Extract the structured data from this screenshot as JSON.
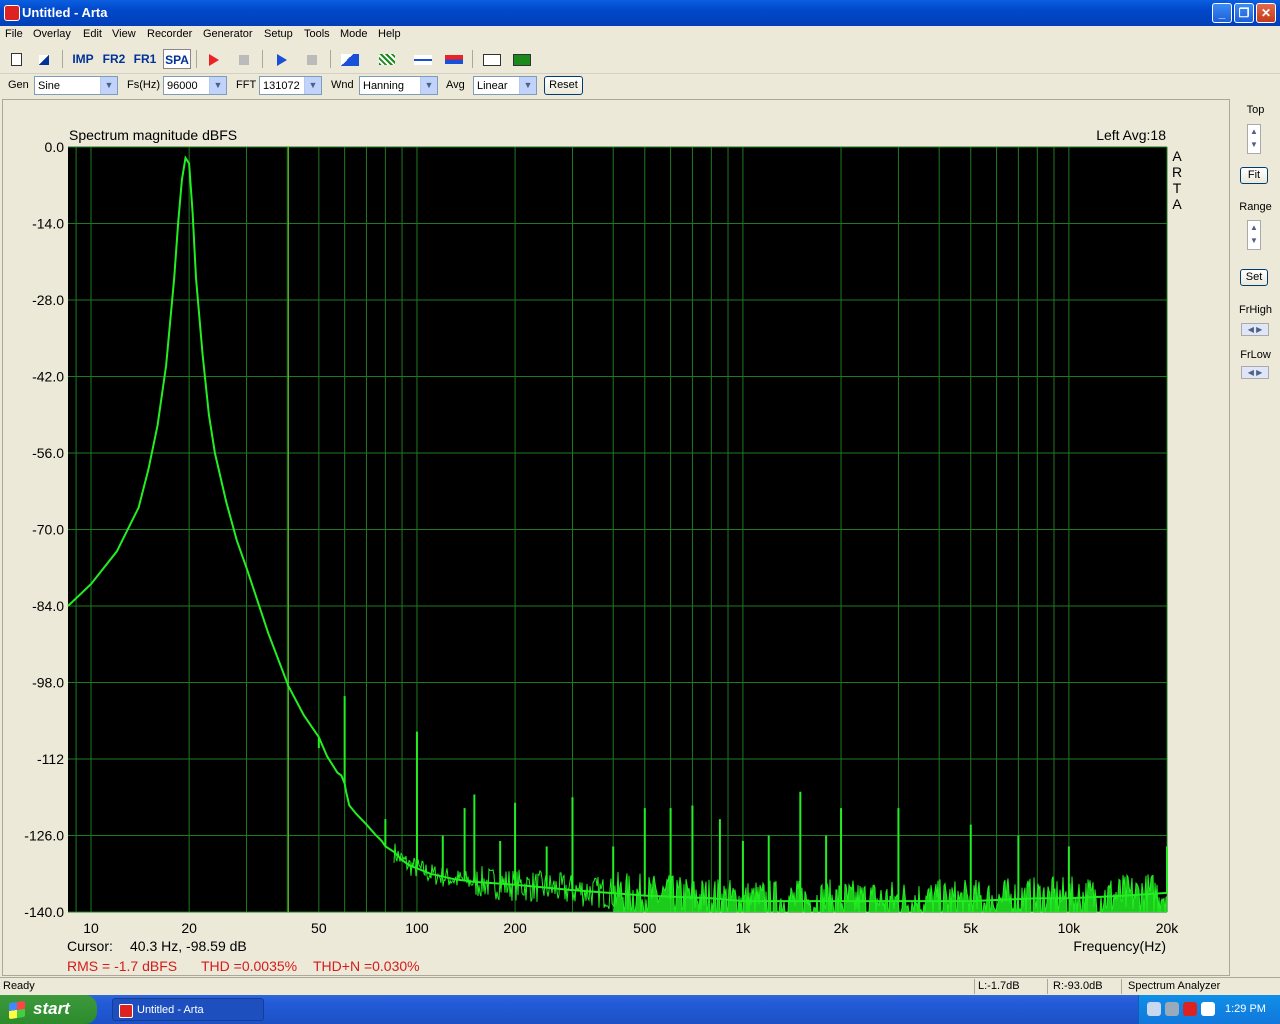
{
  "window": {
    "title": "Untitled - Arta",
    "minimize": "_",
    "maximize": "❐",
    "close": "✕"
  },
  "menu": [
    "File",
    "Overlay",
    "Edit",
    "View",
    "Recorder",
    "Generator",
    "Setup",
    "Tools",
    "Mode",
    "Help"
  ],
  "toolbar": {
    "imp": "IMP",
    "fr2": "FR2",
    "fr1": "FR1",
    "spa": "SPA"
  },
  "controls": {
    "gen_label": "Gen",
    "gen_value": "Sine",
    "fs_label": "Fs(Hz)",
    "fs_value": "96000",
    "fft_label": "FFT",
    "fft_value": "131072",
    "wnd_label": "Wnd",
    "wnd_value": "Hanning",
    "avg_label": "Avg",
    "avg_value": "Linear",
    "reset_label": "Reset"
  },
  "right_panel": {
    "top_label": "Top",
    "fit_label": "Fit",
    "range_label": "Range",
    "set_label": "Set",
    "frhigh_label": "FrHigh",
    "frlow_label": "FrLow"
  },
  "plot": {
    "title": "Spectrum magnitude dBFS",
    "channel_info": "Left  Avg:18",
    "brand": "ARTA",
    "xlabel": "Frequency(Hz)",
    "cursor_label": "Cursor:",
    "cursor_value": "40.3 Hz, -98.59 dB",
    "rms_text": "RMS =   -1.7 dBFS",
    "thd_text": "THD =0.0035%",
    "thdn_text": "THD+N =0.030%"
  },
  "chart_data": {
    "type": "line",
    "title": "Spectrum magnitude dBFS",
    "xlabel": "Frequency(Hz)",
    "ylabel": "",
    "x_scale": "log",
    "xlim": [
      8.5,
      20000
    ],
    "ylim": [
      -140,
      0
    ],
    "y_ticks": [
      "0.0",
      "-14.0",
      "-28.0",
      "-42.0",
      "-56.0",
      "-70.0",
      "-84.0",
      "-98.0",
      "-112",
      "-126.0",
      "-140.0"
    ],
    "y_tick_values": [
      0,
      -14,
      -28,
      -42,
      -56,
      -70,
      -84,
      -98,
      -112,
      -126,
      -140
    ],
    "x_ticks": [
      "10",
      "20",
      "50",
      "100",
      "200",
      "500",
      "1k",
      "2k",
      "5k",
      "10k",
      "20k"
    ],
    "x_tick_values": [
      10,
      20,
      50,
      100,
      200,
      500,
      1000,
      2000,
      5000,
      10000,
      20000
    ],
    "cursor_x": 40.3,
    "grid": true,
    "colors": {
      "background": "#000000",
      "grid": "#1f7a1f",
      "trace": "#22ee22",
      "cursor": "#6ccf2a"
    },
    "series": [
      {
        "x": [
          8.5,
          10,
          12,
          14,
          15,
          16,
          17,
          18,
          18.5,
          19,
          19.5,
          20,
          20.5,
          21,
          22,
          23,
          24,
          26,
          28,
          30,
          35,
          40.3,
          45,
          50,
          53,
          57,
          58.6,
          60,
          60.6,
          62,
          65,
          70,
          75,
          78,
          80,
          85,
          90,
          95,
          100,
          110,
          130,
          150,
          200,
          300,
          500,
          800,
          1000,
          1500,
          2000,
          3000,
          5000,
          8000,
          10000,
          15000,
          20000
        ],
        "y": [
          -84,
          -80,
          -74,
          -66,
          -59,
          -51,
          -40,
          -24,
          -14,
          -6,
          -2,
          -3,
          -12,
          -24,
          -38,
          -49,
          -56,
          -65,
          -72,
          -77,
          -89,
          -98.6,
          -104,
          -108,
          -111.5,
          -114.5,
          -115,
          -116.5,
          -118,
          -120.5,
          -122,
          -124,
          -126,
          -127,
          -128,
          -129,
          -130.5,
          -131.5,
          -132,
          -133,
          -134,
          -134.5,
          -135,
          -136,
          -137,
          -137.5,
          -138,
          -138,
          -138,
          -138,
          -138,
          -137.5,
          -137.5,
          -137,
          -136.5
        ]
      }
    ],
    "peaks": [
      {
        "x": 50,
        "y": -110
      },
      {
        "x": 60,
        "y": -100.5
      },
      {
        "x": 80,
        "y": -123
      },
      {
        "x": 100,
        "y": -107
      },
      {
        "x": 120,
        "y": -126
      },
      {
        "x": 140,
        "y": -121
      },
      {
        "x": 150,
        "y": -118.5
      },
      {
        "x": 180,
        "y": -127
      },
      {
        "x": 200,
        "y": -120
      },
      {
        "x": 250,
        "y": -128
      },
      {
        "x": 300,
        "y": -119
      },
      {
        "x": 400,
        "y": -128
      },
      {
        "x": 500,
        "y": -121
      },
      {
        "x": 600,
        "y": -121
      },
      {
        "x": 700,
        "y": -120.5
      },
      {
        "x": 850,
        "y": -123
      },
      {
        "x": 1000,
        "y": -127
      },
      {
        "x": 1200,
        "y": -126
      },
      {
        "x": 1500,
        "y": -118
      },
      {
        "x": 1800,
        "y": -126
      },
      {
        "x": 2000,
        "y": -121
      },
      {
        "x": 3000,
        "y": -121
      },
      {
        "x": 5000,
        "y": -124
      },
      {
        "x": 7000,
        "y": -126
      },
      {
        "x": 10000,
        "y": -128
      },
      {
        "x": 20000,
        "y": -128
      }
    ]
  },
  "status": {
    "ready": "Ready",
    "left_level": "L:-1.7dB",
    "right_level": "R:-93.0dB",
    "mode": "Spectrum Analyzer"
  },
  "taskbar": {
    "start": "start",
    "task_item": "Untitled - Arta",
    "clock": "1:29 PM"
  }
}
